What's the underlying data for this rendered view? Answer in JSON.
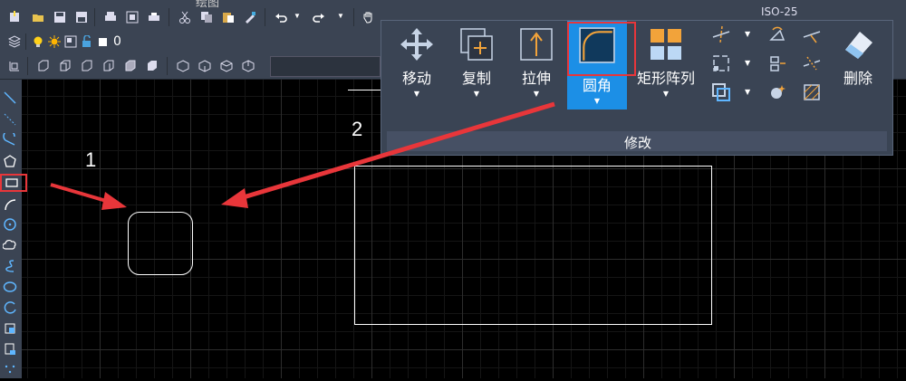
{
  "title_fragment": "绘图",
  "layer_toolbar": {
    "layer_value": "0"
  },
  "status_fragment": "ISO-25",
  "ribbon": {
    "move_label": "移动",
    "copy_label": "复制",
    "stretch_label": "拉伸",
    "fillet_label": "圆角",
    "array_label": "矩形阵列",
    "delete_label": "删除",
    "panel_title": "修改"
  },
  "canvas": {
    "label_1": "1",
    "label_2": "2"
  },
  "colors": {
    "accent_red": "#e8363a",
    "selected_blue": "#1c8fe6",
    "toolbar_bg": "#3b4453"
  }
}
